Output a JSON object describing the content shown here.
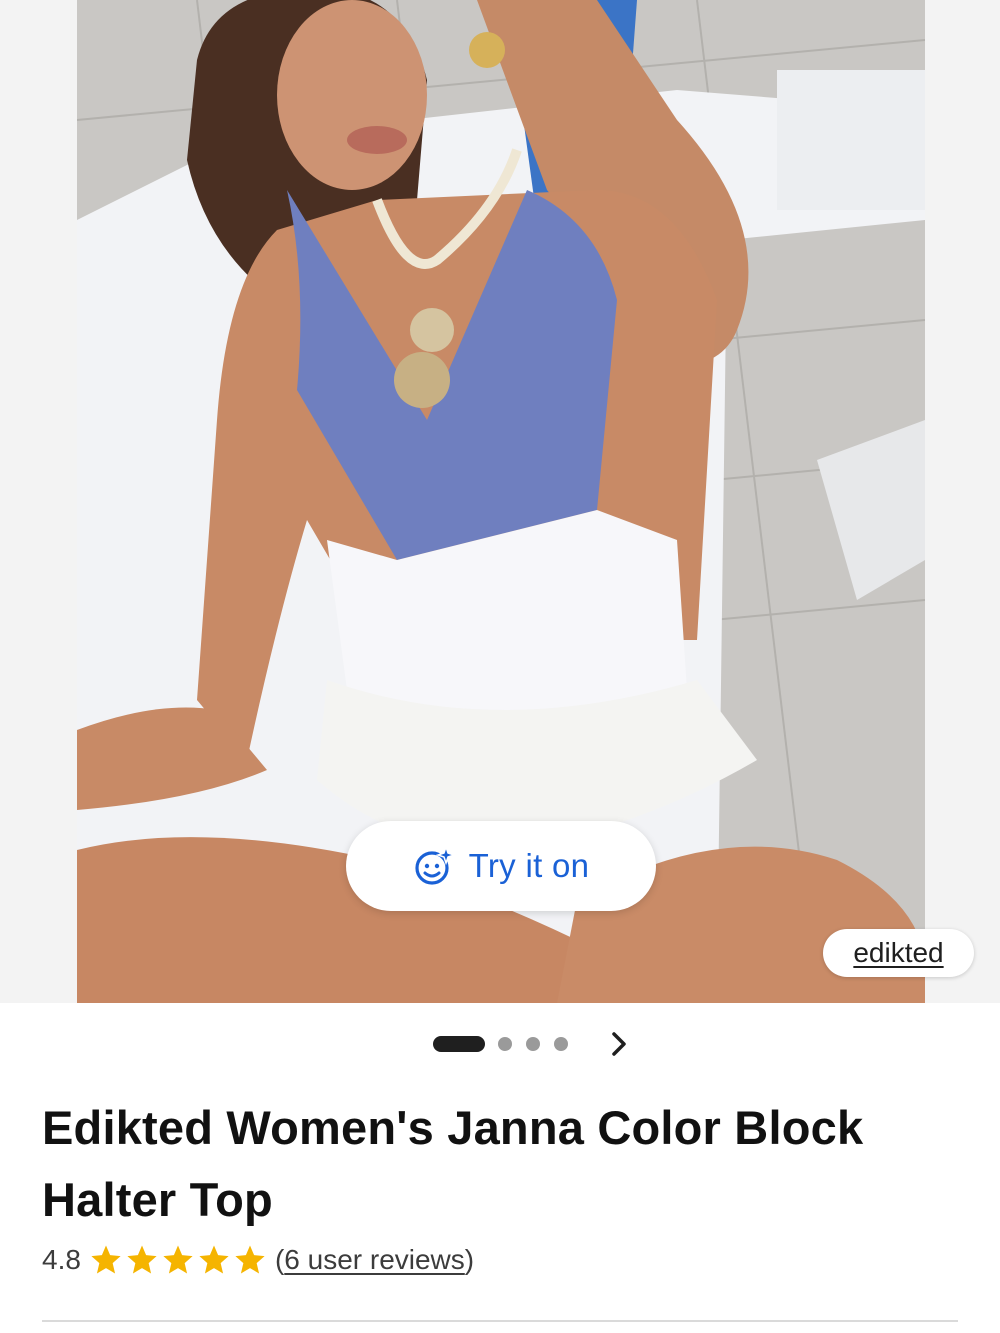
{
  "product_image": {
    "alt_icon": "product-photo",
    "try_on_label": "Try it on",
    "try_on_icon": "face-sparkle-icon",
    "brand_label": "edikted"
  },
  "pager": {
    "total": 4,
    "active_index": 0,
    "next_icon": "chevron-right-icon"
  },
  "product": {
    "title_line1": "Edikted Women's Janna Color Block",
    "title_line2": "Halter Top",
    "rating_value": "4.8",
    "rating_stars": 5,
    "reviews_open": "(",
    "reviews_link": "6 user reviews",
    "reviews_close": ")"
  },
  "colors": {
    "accent_blue": "#1a61d6",
    "star_gold": "#f5b400",
    "top_blue": "#6f7fbf"
  }
}
